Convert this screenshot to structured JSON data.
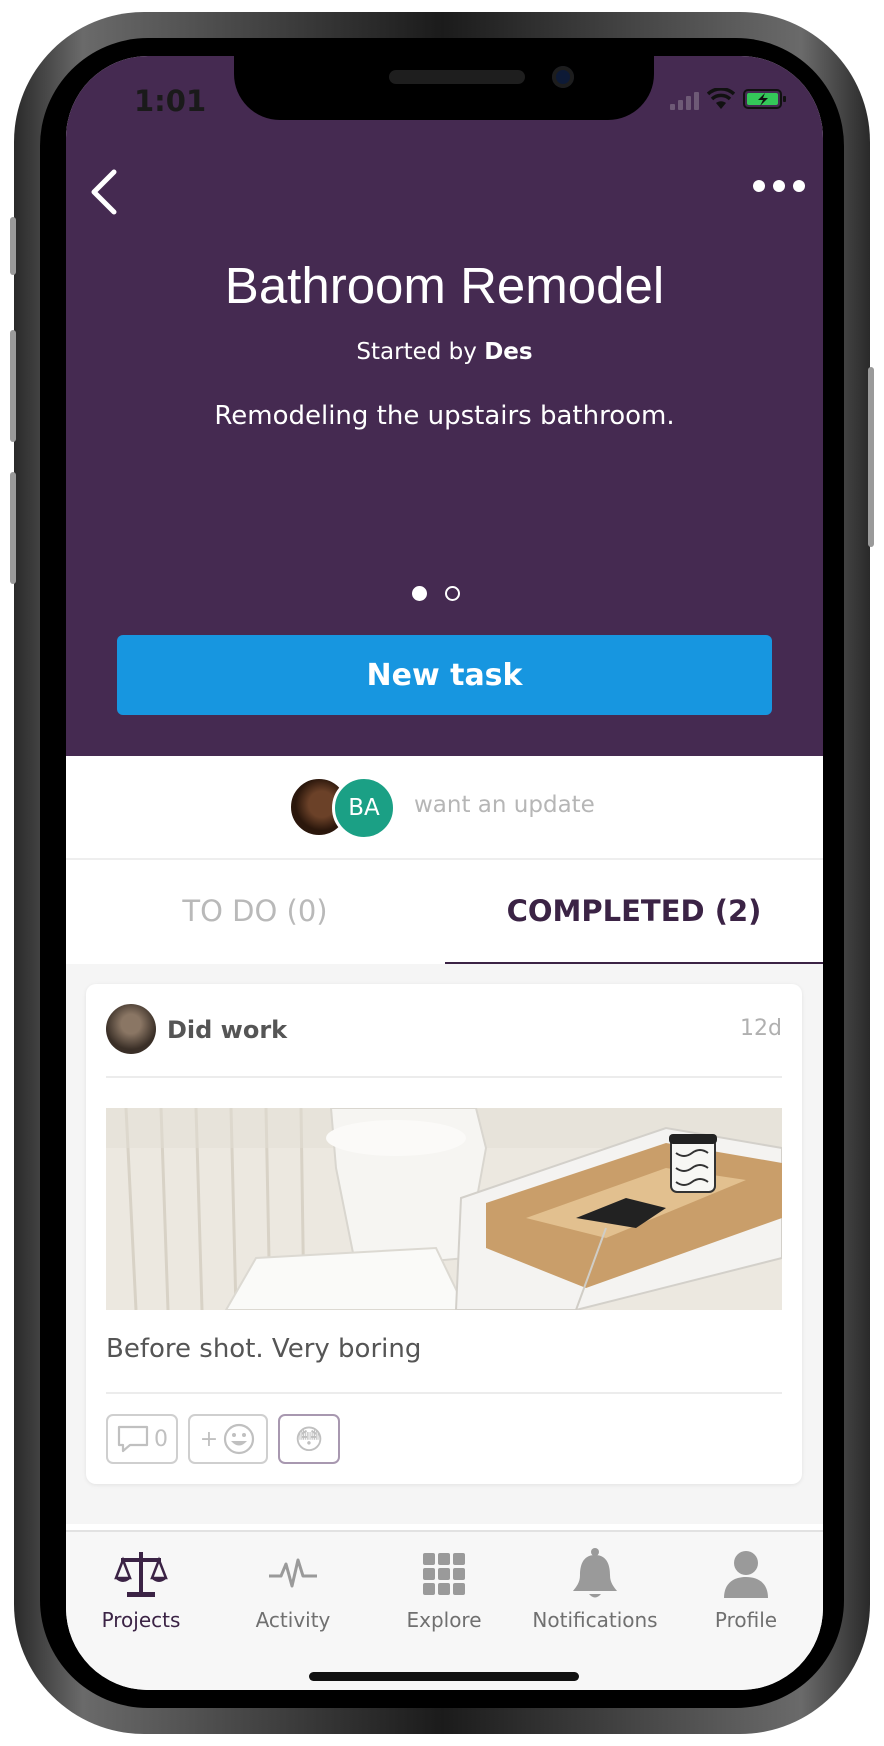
{
  "status_bar": {
    "time": "1:01"
  },
  "project": {
    "title": "Bathroom Remodel",
    "started_by_prefix": "Started by",
    "started_by_name": "Des",
    "description": "Remodeling the upstairs bathroom."
  },
  "pager": {
    "pages": 2,
    "active": 1
  },
  "new_task_label": "New task",
  "watchers": {
    "avatars": [
      {
        "initials": ""
      },
      {
        "initials": "BA"
      }
    ],
    "text": "want an update"
  },
  "tabs": [
    {
      "label": "TO DO (0)",
      "active": false
    },
    {
      "label": "COMPLETED (2)",
      "active": true
    }
  ],
  "feed": [
    {
      "title": "Did work",
      "time": "12d",
      "caption": "Before shot. Very boring",
      "comment_count": "0",
      "reactions": [
        "😳"
      ]
    }
  ],
  "tabbar": [
    {
      "label": "Projects",
      "icon": "scales-icon",
      "active": true
    },
    {
      "label": "Activity",
      "icon": "pulse-icon",
      "active": false
    },
    {
      "label": "Explore",
      "icon": "grid-icon",
      "active": false
    },
    {
      "label": "Notifications",
      "icon": "bell-icon",
      "active": false
    },
    {
      "label": "Profile",
      "icon": "person-icon",
      "active": false
    }
  ],
  "colors": {
    "hero_bg": "#452a51",
    "primary_button": "#1796e0",
    "accent": "#3b2345",
    "avatar_teal": "#1ba085"
  }
}
